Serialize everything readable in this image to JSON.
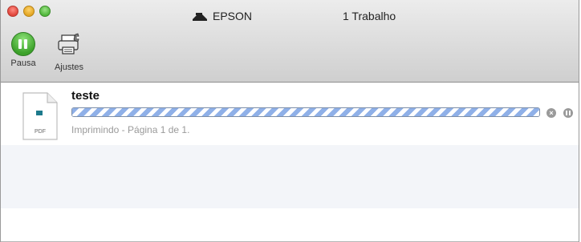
{
  "window": {
    "printer_name": "EPSON",
    "job_count": "1 Trabalho",
    "printer_icon": "printer-icon"
  },
  "traffic_lights": {
    "close": "close-icon",
    "minimize": "minimize-icon",
    "zoom": "zoom-icon"
  },
  "toolbar": {
    "pause_label": "Pausa",
    "settings_label": "Ajustes",
    "pause_icon": "pause-icon",
    "settings_icon": "printer-settings-icon"
  },
  "job": {
    "name": "teste",
    "file_type": "PDF",
    "progress": 1.0,
    "status": "Imprimindo - Página 1 de 1.",
    "cancel_icon": "cancel-icon",
    "hold_icon": "hold-icon"
  },
  "colors": {
    "pause_green": "#3ca12a",
    "progress_stripe": "#8fb0e8",
    "stripe_row": "#f3f5f9"
  }
}
